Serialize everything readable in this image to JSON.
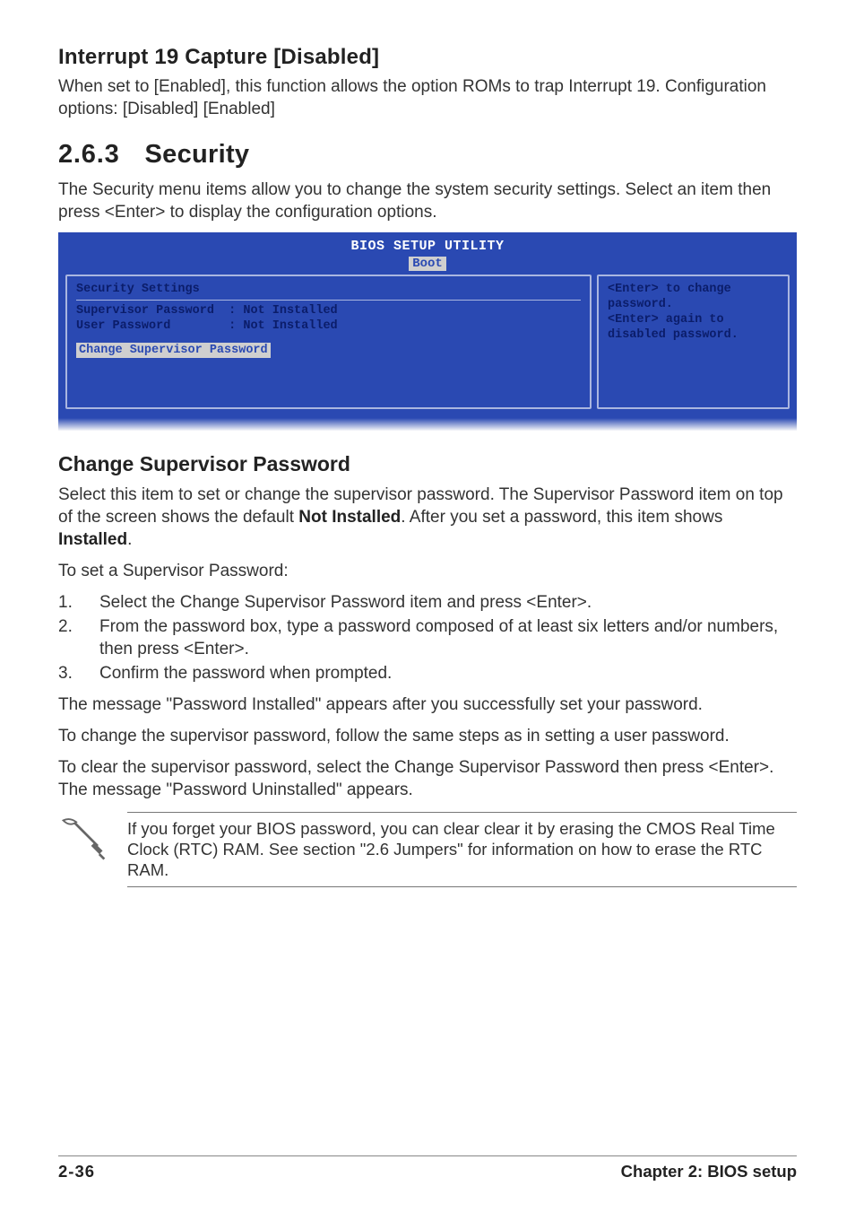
{
  "section_interrupt": {
    "heading": "Interrupt 19 Capture [Disabled]",
    "body": "When set to [Enabled], this function allows the option ROMs to trap Interrupt 19. Configuration options: [Disabled] [Enabled]"
  },
  "section_security": {
    "number": "2.6.3",
    "title": "Security",
    "intro": "The Security menu items allow you to change the system security settings. Select an item then press <Enter> to display the configuration options."
  },
  "bios": {
    "title": "BIOS SETUP UTILITY",
    "tab": "Boot",
    "header": "Security Settings",
    "rows": [
      {
        "label": "Supervisor Password",
        "value": ": Not Installed"
      },
      {
        "label": "User Password",
        "value": ": Not Installed"
      }
    ],
    "selected": "Change Supervisor Password",
    "help": "<Enter> to change password.\n<Enter> again to disabled password."
  },
  "change_supervisor": {
    "heading": "Change Supervisor Password",
    "p1_a": "Select this item to set or change the supervisor password. The Supervisor Password item on top of the screen shows the default ",
    "p1_b1": "Not Installed",
    "p1_c": ". After you set a password, this item shows ",
    "p1_b2": "Installed",
    "p1_d": ".",
    "p2": "To set a Supervisor Password:",
    "steps": [
      "Select the Change Supervisor Password item and press <Enter>.",
      "From the password box, type a password composed of at least six letters and/or numbers, then press <Enter>.",
      "Confirm the password when prompted."
    ],
    "p3": "The message \"Password Installed\" appears after you successfully set your password.",
    "p4": "To change the supervisor password, follow the same steps as in setting a user password.",
    "p5": "To clear the supervisor password, select the Change Supervisor Password then press <Enter>. The message \"Password Uninstalled\" appears."
  },
  "note": {
    "text": "If you forget your BIOS password, you can clear clear it by erasing the CMOS Real Time Clock (RTC) RAM. See section \"2.6  Jumpers\" for information on how to erase the RTC RAM."
  },
  "footer": {
    "page": "2-36",
    "chapter": "Chapter 2: BIOS setup"
  }
}
